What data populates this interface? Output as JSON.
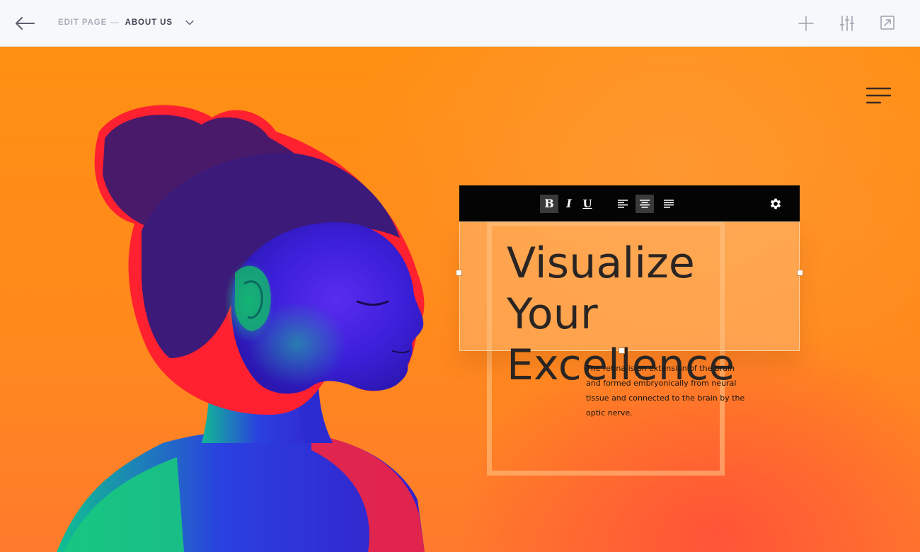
{
  "header": {
    "breadcrumb_prefix": "EDIT PAGE",
    "breadcrumb_separator": "—",
    "current_page": "ABOUT US",
    "back_icon": "arrow-left-icon",
    "dropdown_icon": "chevron-down-icon",
    "actions": [
      {
        "icon": "plus-icon"
      },
      {
        "icon": "sliders-icon"
      },
      {
        "icon": "external-link-icon"
      }
    ]
  },
  "canvas": {
    "menu_icon": "hamburger-menu-icon",
    "colors": {
      "background": "#ff8a1c",
      "text": "#2a2522"
    }
  },
  "text_block": {
    "headline_line1": "Visualize Your",
    "headline_line2": "Excellence",
    "body": "The retina is an extension of the brain and formed embryonically from neural tissue and connected to the brain by the optic nerve."
  },
  "format_toolbar": {
    "bold": "B",
    "italic": "I",
    "underline": "U",
    "active_buttons": [
      "bold",
      "align-center"
    ],
    "settings_icon": "gear-icon"
  }
}
